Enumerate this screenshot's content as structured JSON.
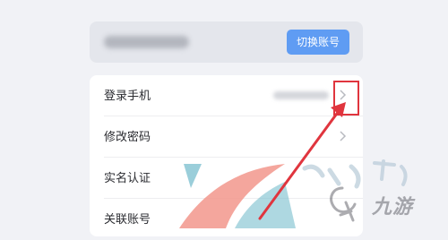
{
  "account": {
    "switch_label": "切换账号"
  },
  "menu": {
    "items": [
      {
        "label": "登录手机"
      },
      {
        "label": "修改密码"
      },
      {
        "label": "实名认证"
      },
      {
        "label": "关联账号"
      }
    ]
  },
  "watermark": {
    "text": "九游"
  },
  "colors": {
    "accent": "#5f9cf3",
    "annotation": "#e0353e"
  },
  "icons": {
    "row_arrow": "chevron-right-icon",
    "callout": "arrow-annotation"
  }
}
